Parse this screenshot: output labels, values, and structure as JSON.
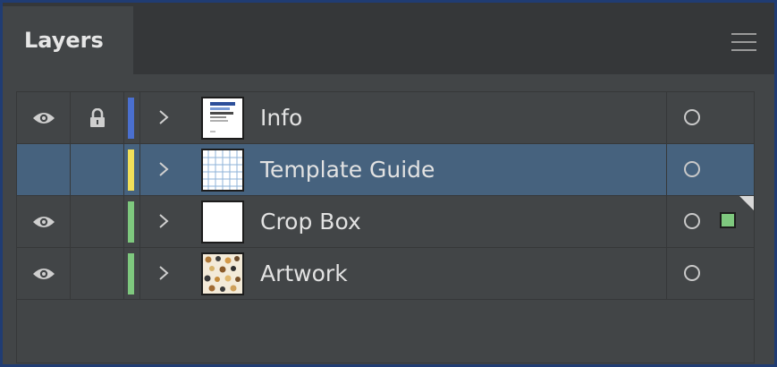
{
  "panel": {
    "tab_title": "Layers",
    "menu_icon": "hamburger-menu-icon"
  },
  "layers": [
    {
      "name": "Info",
      "visible": true,
      "locked": true,
      "color": "#4a6fcf",
      "selected": false,
      "has_selection_square": false,
      "thumbnail": "info-thumbnail"
    },
    {
      "name": "Template Guide",
      "visible": false,
      "locked": false,
      "color": "#f2e05a",
      "selected": true,
      "has_selection_square": false,
      "thumbnail": "grid-thumbnail"
    },
    {
      "name": "Crop Box",
      "visible": true,
      "locked": false,
      "color": "#7ec87e",
      "selected": false,
      "has_selection_square": true,
      "thumbnail": "blank-thumbnail"
    },
    {
      "name": "Artwork",
      "visible": true,
      "locked": false,
      "color": "#7ec87e",
      "selected": false,
      "has_selection_square": false,
      "thumbnail": "pattern-thumbnail"
    }
  ]
}
